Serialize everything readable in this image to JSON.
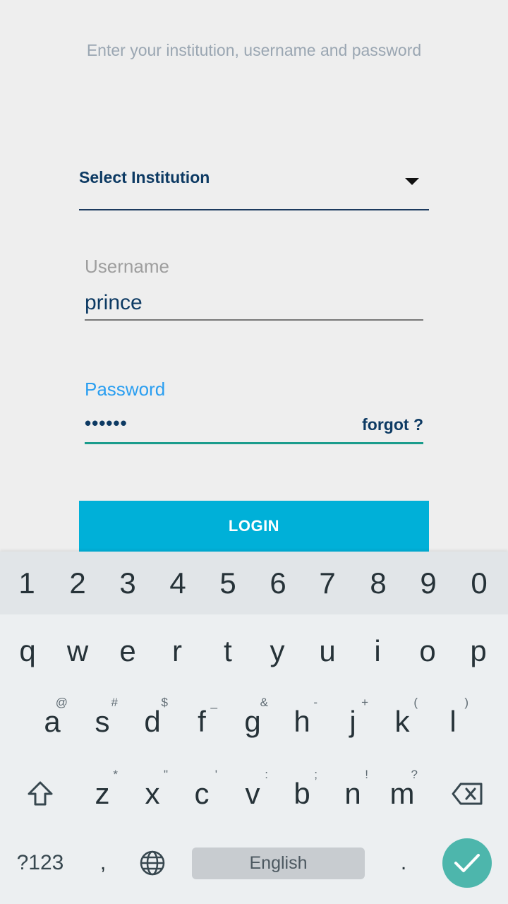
{
  "header": {
    "subtitle": "Enter your institution, username and password"
  },
  "institution": {
    "placeholder": "Select Institution"
  },
  "username": {
    "label": "Username",
    "value": "prince"
  },
  "password": {
    "label": "Password",
    "value": "••••••",
    "forgot_label": "forgot ?"
  },
  "login": {
    "label": "LOGIN"
  },
  "keyboard": {
    "numbers": [
      "1",
      "2",
      "3",
      "4",
      "5",
      "6",
      "7",
      "8",
      "9",
      "0"
    ],
    "row1": [
      "q",
      "w",
      "e",
      "r",
      "t",
      "y",
      "u",
      "i",
      "o",
      "p"
    ],
    "row2": [
      {
        "k": "a",
        "h": "@"
      },
      {
        "k": "s",
        "h": "#"
      },
      {
        "k": "d",
        "h": "$"
      },
      {
        "k": "f",
        "h": "_"
      },
      {
        "k": "g",
        "h": "&"
      },
      {
        "k": "h",
        "h": "-"
      },
      {
        "k": "j",
        "h": "+"
      },
      {
        "k": "k",
        "h": "("
      },
      {
        "k": "l",
        "h": ")"
      }
    ],
    "row3": [
      {
        "k": "z",
        "h": "*"
      },
      {
        "k": "x",
        "h": "\""
      },
      {
        "k": "c",
        "h": "'"
      },
      {
        "k": "v",
        "h": ":"
      },
      {
        "k": "b",
        "h": ";"
      },
      {
        "k": "n",
        "h": "!"
      },
      {
        "k": "m",
        "h": "?"
      }
    ],
    "symbols_label": "?123",
    "comma": ",",
    "space_label": "English",
    "period": ".",
    "icons": {
      "shift": "shift-icon",
      "backspace": "backspace-icon",
      "globe": "globe-icon",
      "enter": "check-icon"
    },
    "colors": {
      "accent": "#00b0d8",
      "enter": "#4db6ac"
    }
  }
}
